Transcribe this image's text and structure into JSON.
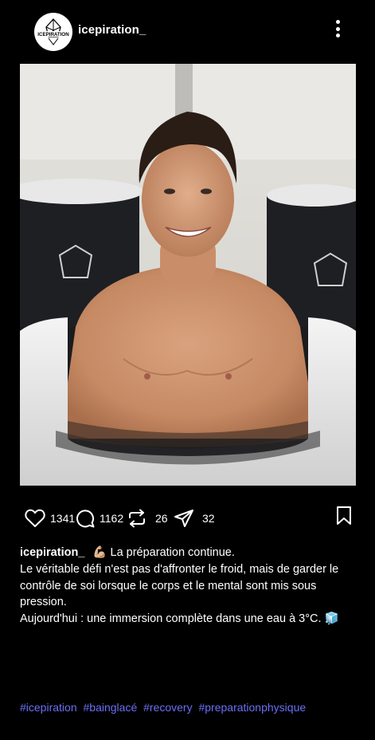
{
  "account": {
    "username": "icepiration_",
    "logo_text": "ICEPIRATION"
  },
  "header": {
    "menu_icon": "more-vertical-icon"
  },
  "post_image": {
    "alt": ""
  },
  "actions": {
    "likes": "1341",
    "comments": "1162",
    "reposts": "26",
    "shares": "32",
    "icons": [
      "heart-icon",
      "comment-icon",
      "repost-icon",
      "send-icon",
      "bookmark-icon"
    ]
  },
  "caption": {
    "username": "icepiration_",
    "line1": "💪🏼 La préparation continue.",
    "line2": "Le véritable défi n'est pas d'affronter le froid, mais de garder le contrôle de soi lorsque le corps et le mental sont mis sous pression.",
    "line3": "Aujourd'hui : une immersion complète dans une eau à 3°C. 🧊"
  },
  "hashtags": [
    "#icepiration",
    "#bainglacé",
    "#recovery",
    "#preparationphysique"
  ],
  "colors": {
    "background": "#000000",
    "text": "#ffffff",
    "hashtag": "#6b6ff5"
  }
}
